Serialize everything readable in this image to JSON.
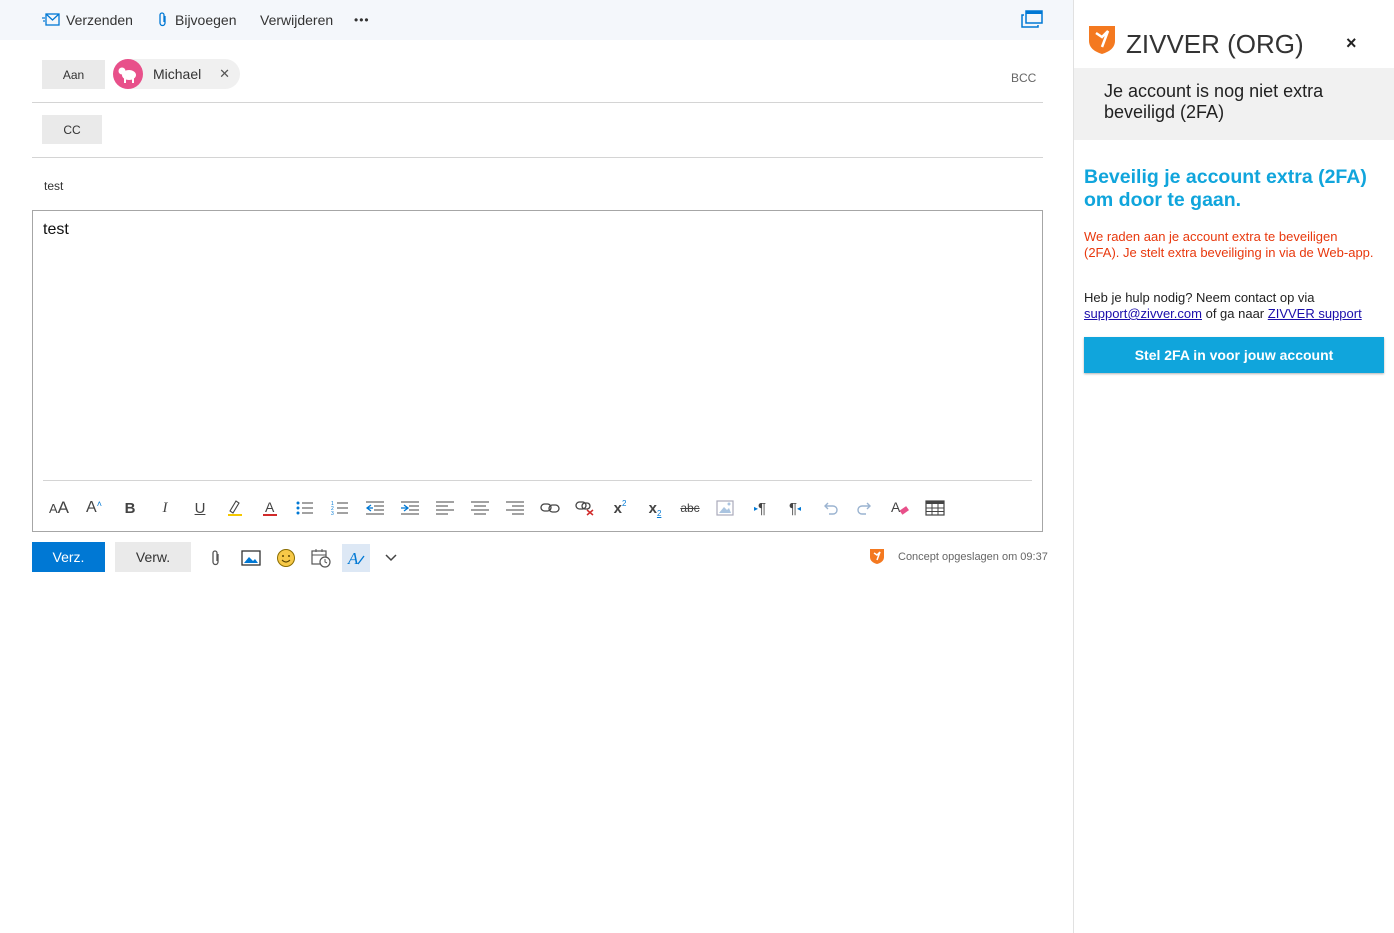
{
  "toolbar": {
    "send_label": "Verzenden",
    "attach_label": "Bijvoegen",
    "discard_label": "Verwijderen",
    "more_label": "•••"
  },
  "recipients": {
    "to_label": "Aan",
    "to_chip_name": "Michael",
    "bcc_label": "BCC",
    "cc_label": "CC"
  },
  "subject": "test",
  "body": "test",
  "format_bar": {
    "items": [
      "font-size-icon",
      "grow-font-icon",
      "bold-icon",
      "italic-icon",
      "underline-icon",
      "highlight-icon",
      "font-color-icon",
      "bullets-icon",
      "numbering-icon",
      "decrease-indent-icon",
      "increase-indent-icon",
      "align-left-icon",
      "align-center-icon",
      "align-right-icon",
      "insert-link-icon",
      "remove-link-icon",
      "superscript-icon",
      "subscript-icon",
      "strikethrough-icon",
      "insert-image-icon",
      "ltr-icon",
      "rtl-icon",
      "undo-icon",
      "redo-icon",
      "clear-format-icon",
      "insert-table-icon"
    ]
  },
  "footer": {
    "send_short": "Verz.",
    "discard_short": "Verw.",
    "saved_status": "Concept opgeslagen om 09:37"
  },
  "zivver": {
    "title": "ZIVVER (ORG)",
    "close": "×",
    "notice": "Je account is nog niet extra beveiligd (2FA)",
    "heading": "Beveilig je account extra (2FA) om door te gaan.",
    "warning": "We raden aan je account extra te beveiligen (2FA). Je stelt extra beveiliging in via de Web-app.",
    "help_text": "Heb je hulp nodig? Neem contact op via",
    "help_email": "support@zivver.com",
    "help_middle": "of ga naar",
    "help_link": "ZIVVER support",
    "setup_button": "Stel 2FA in voor jouw account",
    "accent_color": "#10a5dc",
    "warning_color": "#e8380d",
    "logo_color": "#f47920"
  }
}
